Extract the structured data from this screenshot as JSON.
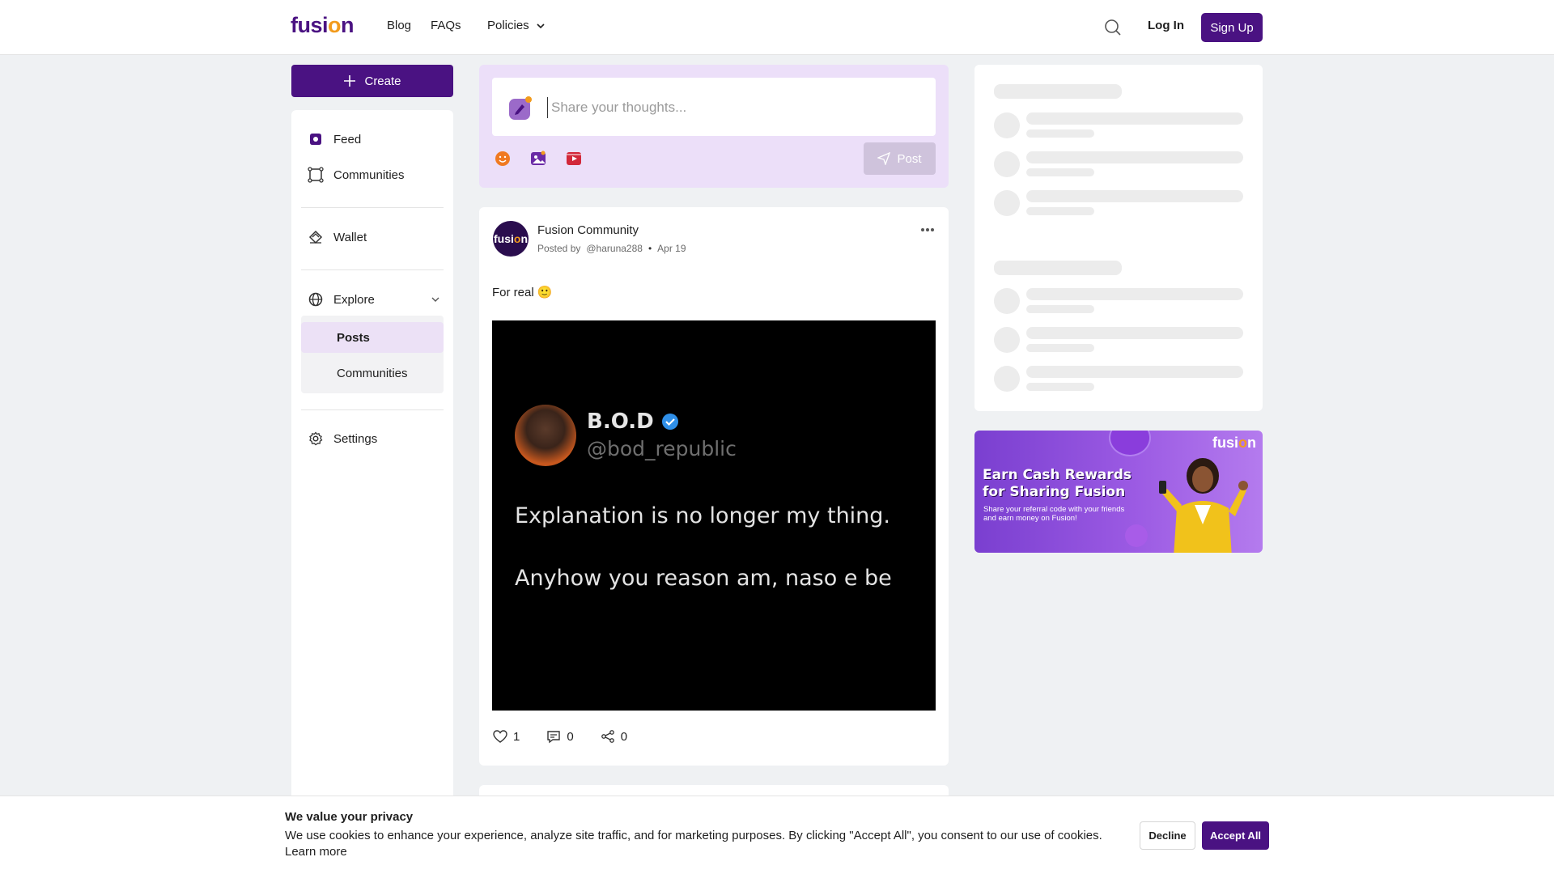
{
  "header": {
    "logo_prefix": "fusi",
    "logo_dot": "o",
    "logo_suffix": "n",
    "nav": {
      "blog": "Blog",
      "faqs": "FAQs",
      "policies": "Policies"
    },
    "search_icon": "search-icon",
    "login_label": "Log In",
    "signup_label": "Sign Up"
  },
  "sidebar": {
    "create_label": "Create",
    "items": {
      "feed": "Feed",
      "communities": "Communities",
      "wallet": "Wallet",
      "explore": "Explore",
      "settings": "Settings"
    },
    "explore_sub": {
      "posts": "Posts",
      "communities": "Communities",
      "active": "Posts"
    }
  },
  "composer": {
    "placeholder": "Share your thoughts...",
    "value": "",
    "post_label": "Post",
    "tools": [
      "emoji-icon",
      "image-icon",
      "video-icon"
    ]
  },
  "post": {
    "author": "Fusion Community",
    "avatar_text_prefix": "fusi",
    "avatar_text_dot": "o",
    "avatar_text_suffix": "n",
    "posted_by_label": "Posted by",
    "handle": "@haruna288",
    "separator": "•",
    "date": "Apr 19",
    "text": "For real 🙂",
    "media": {
      "name": "B.O.D",
      "handle": "@bod_republic",
      "line1": "Explanation is no longer my thing.",
      "line2": "Anyhow you reason am, naso e be"
    },
    "likes": "1",
    "comments": "0",
    "shares": "0"
  },
  "promo": {
    "title_line1": "Earn Cash Rewards",
    "title_line2": "for Sharing Fusion",
    "subtitle": "Share your referral code with your friends and earn money on Fusion!",
    "logo_prefix": "fusi",
    "logo_dot": "o",
    "logo_suffix": "n"
  },
  "cookie": {
    "title": "We value your privacy",
    "text": "We use cookies to enhance your experience, analyze site traffic, and for marketing purposes. By clicking \"Accept All\", you consent to our use of cookies.",
    "learn_more": "Learn more",
    "decline_label": "Decline",
    "accept_label": "Accept All"
  },
  "colors": {
    "brand": "#4a1282",
    "accent": "#f29b1d",
    "composer_bg": "#ecdff9",
    "active_item_bg": "#ece1f6"
  }
}
